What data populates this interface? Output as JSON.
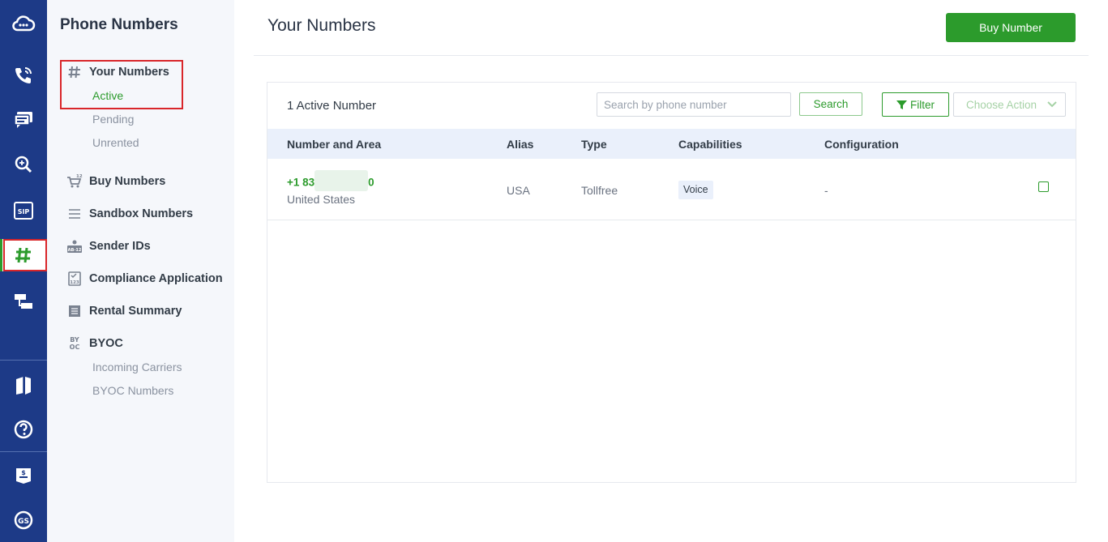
{
  "sidebar": {
    "title": "Phone Numbers",
    "your_numbers": "Your Numbers",
    "active": "Active",
    "pending": "Pending",
    "unrented": "Unrented",
    "buy_numbers": "Buy Numbers",
    "sandbox_numbers": "Sandbox Numbers",
    "sender_ids": "Sender IDs",
    "compliance_application": "Compliance Application",
    "rental_summary": "Rental Summary",
    "byoc": "BYOC",
    "incoming_carriers": "Incoming Carriers",
    "byoc_numbers": "BYOC Numbers"
  },
  "icon_text": {
    "buy_badge": "123",
    "sender_badge": "AB-12",
    "compliance_badge": "123",
    "byoc_top": "BY",
    "byoc_bottom": "OC",
    "sip": "SIP",
    "gs": "GS"
  },
  "header": {
    "title": "Your Numbers",
    "buy_button": "Buy Number"
  },
  "toolbar": {
    "count": "1 Active Number",
    "search_placeholder": "Search by phone number",
    "search_button": "Search",
    "filter_button": "Filter",
    "action_select": "Choose Action"
  },
  "table": {
    "headers": [
      "Number and Area",
      "Alias",
      "Type",
      "Capabilities",
      "Configuration"
    ],
    "rows": [
      {
        "number_prefix": "+1 83",
        "number_suffix": "0",
        "area": "United States",
        "alias": "USA",
        "type": "Tollfree",
        "capability": "Voice",
        "configuration": "-"
      }
    ]
  },
  "colors": {
    "rail": "#1d3a87",
    "accent": "#2c9b2c",
    "highlight": "#d9262a"
  }
}
